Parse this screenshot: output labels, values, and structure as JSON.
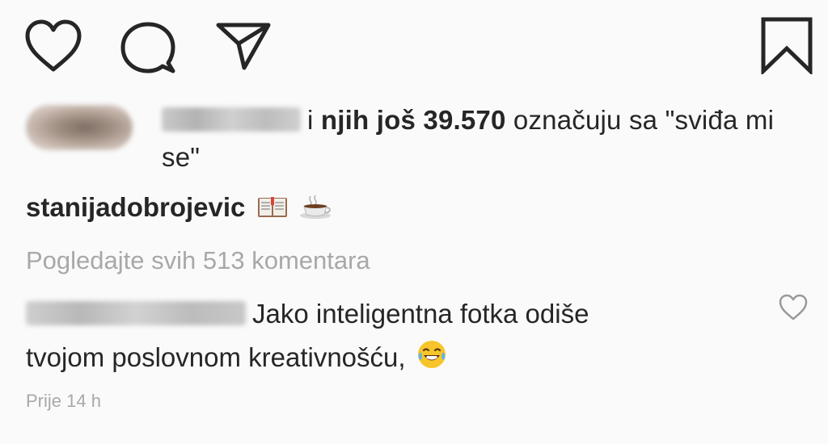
{
  "actions": {
    "like_icon": "heart-icon",
    "comment_icon": "comment-bubble-icon",
    "share_icon": "paper-plane-icon",
    "save_icon": "bookmark-icon"
  },
  "likes": {
    "liker_username_blurred": "",
    "middle_connector": "i",
    "bold_part": "njih još 39.570",
    "suffix": "označuju sa \"sviđa mi se\""
  },
  "caption": {
    "username": "stanijadobrojevic",
    "emojis": [
      "open-book-emoji",
      "coffee-emoji"
    ]
  },
  "view_comments": "Pogledajte svih 513 komentara",
  "comment": {
    "text_line1": "Jako inteligentna fotka odiše",
    "text_line2": "tvojom poslovnom kreativnošću,",
    "emoji": "laughing-tears-emoji",
    "like_icon": "small-heart-icon"
  },
  "timestamp": "Prije 14 h",
  "colors": {
    "text": "#262626",
    "muted": "#a8a8a8",
    "background": "#fafafa"
  }
}
